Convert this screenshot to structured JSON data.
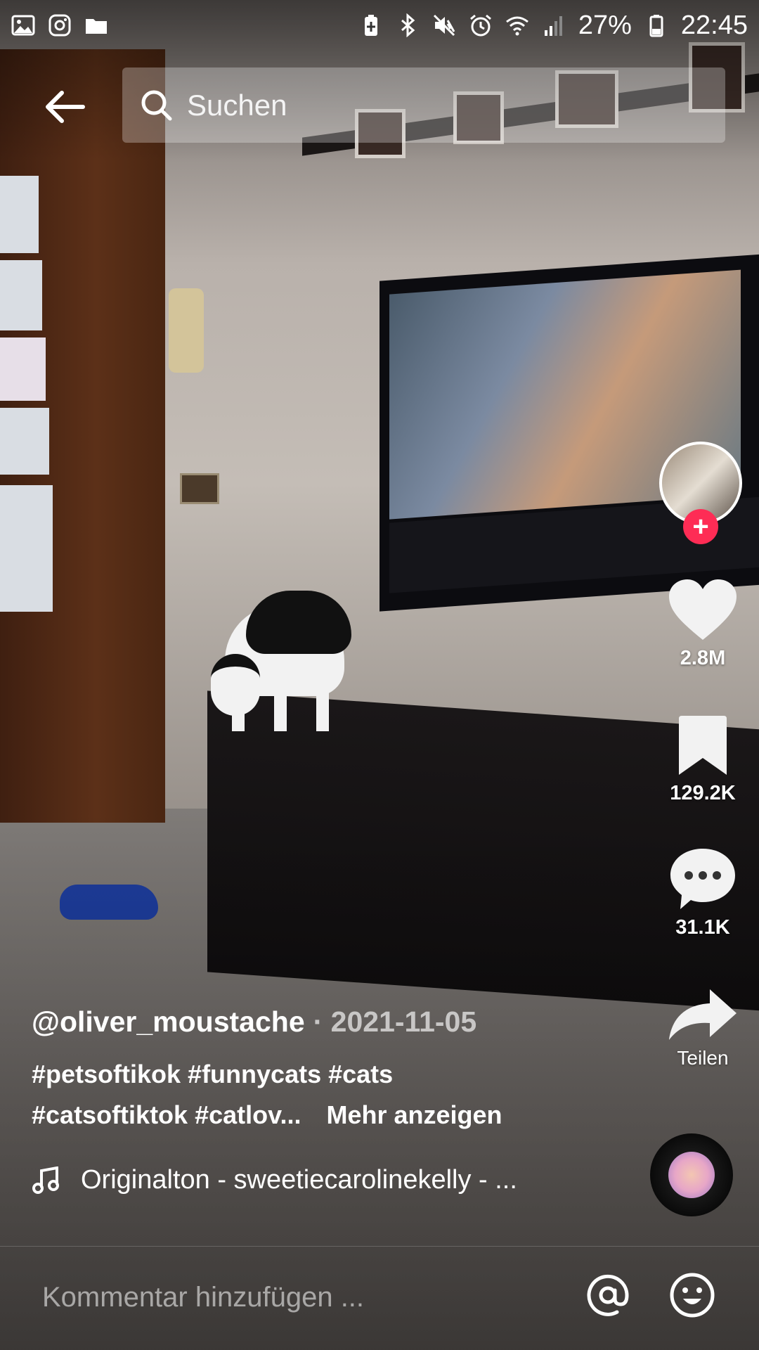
{
  "status_bar": {
    "battery_percent": "27%",
    "time": "22:45",
    "left_icons": [
      "gallery-icon",
      "instagram-icon",
      "folder-icon"
    ],
    "right_icons": [
      "battery-saver-icon",
      "bluetooth-icon",
      "mute-icon",
      "alarm-icon",
      "wifi-icon",
      "signal-icon",
      "battery-icon"
    ]
  },
  "search": {
    "placeholder": "Suchen"
  },
  "actions": {
    "likes": "2.8M",
    "favorites": "129.2K",
    "comments": "31.1K",
    "share_label": "Teilen"
  },
  "video": {
    "author": "@oliver_moustache",
    "date": "· 2021-11-05",
    "description_line1": "#petsoftikok #funnycats #cats",
    "description_line2": "#catsoftiktok #catlov...",
    "more_label": "Mehr anzeigen",
    "music": "Originalton - sweetiecarolinekelly - ..."
  },
  "comment": {
    "placeholder": "Kommentar hinzufügen ..."
  },
  "colors": {
    "follow_accent": "#fe2c55",
    "text": "#ffffff"
  }
}
